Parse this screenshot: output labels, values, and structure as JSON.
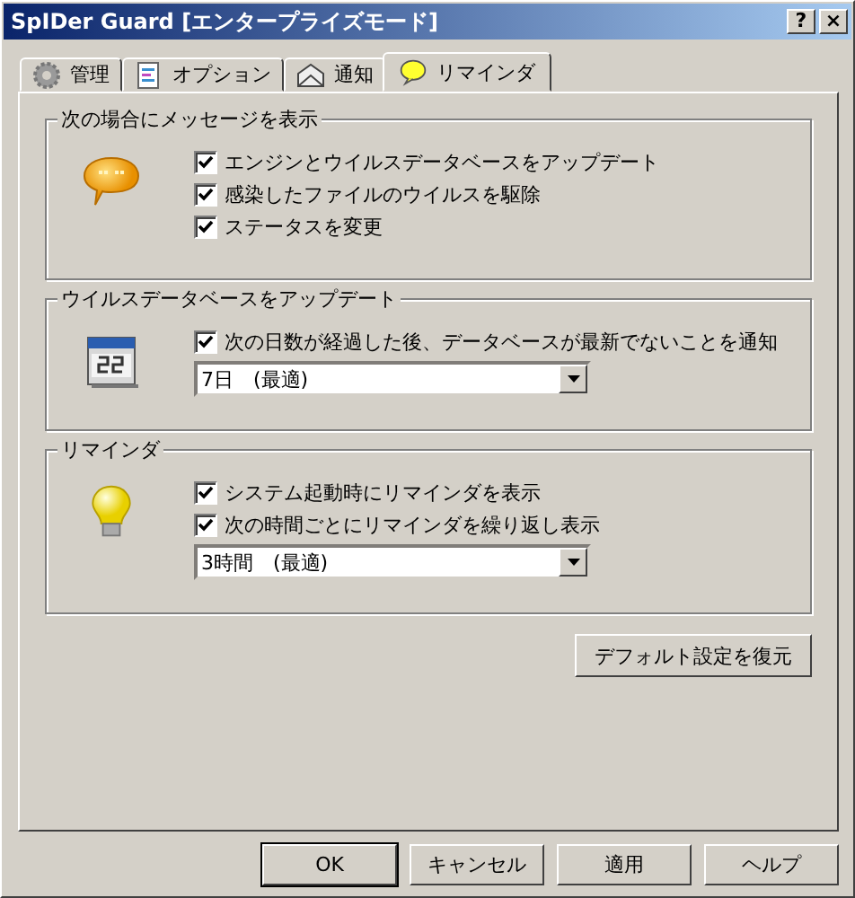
{
  "window": {
    "title": "SpIDer Guard [エンタープライズモード]",
    "help_button": "?",
    "close_button": "×"
  },
  "tabs": [
    {
      "label": "管理",
      "kind": "gear",
      "selected": false
    },
    {
      "label": "オプション",
      "kind": "document",
      "selected": false
    },
    {
      "label": "通知",
      "kind": "envelope",
      "selected": false
    },
    {
      "label": "リマインダ",
      "kind": "bubble",
      "selected": true
    }
  ],
  "groups": [
    {
      "title": "次の場合にメッセージを表示",
      "kind": "message",
      "checkboxes": [
        {
          "label": "エンジンとウイルスデータベースをアップデート",
          "checked": true
        },
        {
          "label": "感染したファイルのウイルスを駆除",
          "checked": true
        },
        {
          "label": "ステータスを変更",
          "checked": true
        }
      ]
    },
    {
      "title": "ウイルスデータベースをアップデート",
      "kind": "calendar",
      "checkboxes": [
        {
          "label": "次の日数が経過した後、データベースが最新でないことを通知",
          "checked": true
        }
      ],
      "dropdown": {
        "value": "7日　(最適)"
      }
    },
    {
      "title": "リマインダ",
      "kind": "bulb",
      "checkboxes": [
        {
          "label": "システム起動時にリマインダを表示",
          "checked": true
        },
        {
          "label": "次の時間ごとにリマインダを繰り返し表示",
          "checked": true
        }
      ],
      "dropdown": {
        "value": "3時間　(最適)"
      }
    }
  ],
  "restore_button": "デフォルト設定を復元",
  "buttons": [
    {
      "label": "OK",
      "default": true
    },
    {
      "label": "キャンセル",
      "default": false
    },
    {
      "label": "適用",
      "default": false
    },
    {
      "label": "ヘルプ",
      "default": false
    }
  ]
}
